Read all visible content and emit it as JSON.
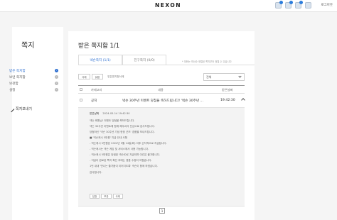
{
  "header": {
    "logo": "NEXON",
    "logout": "로그아웃",
    "icons": [
      "notification-icon",
      "note-icon",
      "mail-icon",
      "friend-icon"
    ]
  },
  "sidebar": {
    "title": "쪽지",
    "items": [
      {
        "label": "받은 쪽지함",
        "active": true
      },
      {
        "label": "보낸 쪽지함",
        "active": false
      },
      {
        "label": "보관함",
        "active": false
      },
      {
        "label": "설정",
        "active": false
      }
    ],
    "write_label": "쪽지보내기"
  },
  "main": {
    "title": "받은 쪽지함 1/1",
    "tabs": [
      {
        "label": "넥슨쪽지 (1/1)",
        "active": true
      },
      {
        "label": "친구쪽지 (0/0)",
        "active": false
      }
    ],
    "tab_note": "* 대화는 최신순 정렬된 쪽지부터 정렬 수 있습니다",
    "toolbar": {
      "delete": "삭제",
      "read": "읽음",
      "link": "받은편지함삭제"
    },
    "filter": "전체",
    "columns": {
      "category": "카테고리",
      "content": "내용",
      "date": "받은날짜"
    },
    "row": {
      "category": "공지",
      "content": "넥슨 30주년 이벤트 당첨을 축하드립니다! '넥슨 30주년 ...",
      "time": "19:42:30"
    },
    "detail": {
      "meta_label": "받은날짜",
      "meta_value": "2024-05-14 19:42:30",
      "lines": [
        "넥슨 회원님! 이벤트 당첨을 축하드립니다.",
        "넥슨 30주년 이벤트에 함께 해주셔서 진심으로 감사드립니다.",
        "당첨하신 '넥슨 30주년 기념 한정 굿즈' 경품을 보내드립니다.",
        "■ '넥슨캐시 5만원' 지급 안내 사항",
        "- 넥슨캐시 5만원은 2024년 5월 14일(화) 이후 순차적으로 지급됩니다.",
        "- 넥슨캐시는 넥슨 게임 및 서비스에서 사용 가능합니다.",
        "- 넥슨캐시 5만원은 당첨된 넥슨ID로 지급되며 이관은 불가합니다.",
        "- 지급이 완료된 쪽지 확인 후에는 경품 수령이 어렵습니다.",
        "1년 내내 '만나는 즐거움이 이어지도록' 넥슨이 함께 하겠습니다.",
        "감사합니다."
      ],
      "actions": [
        "답장",
        "보관",
        "삭제"
      ]
    },
    "page": "1"
  }
}
